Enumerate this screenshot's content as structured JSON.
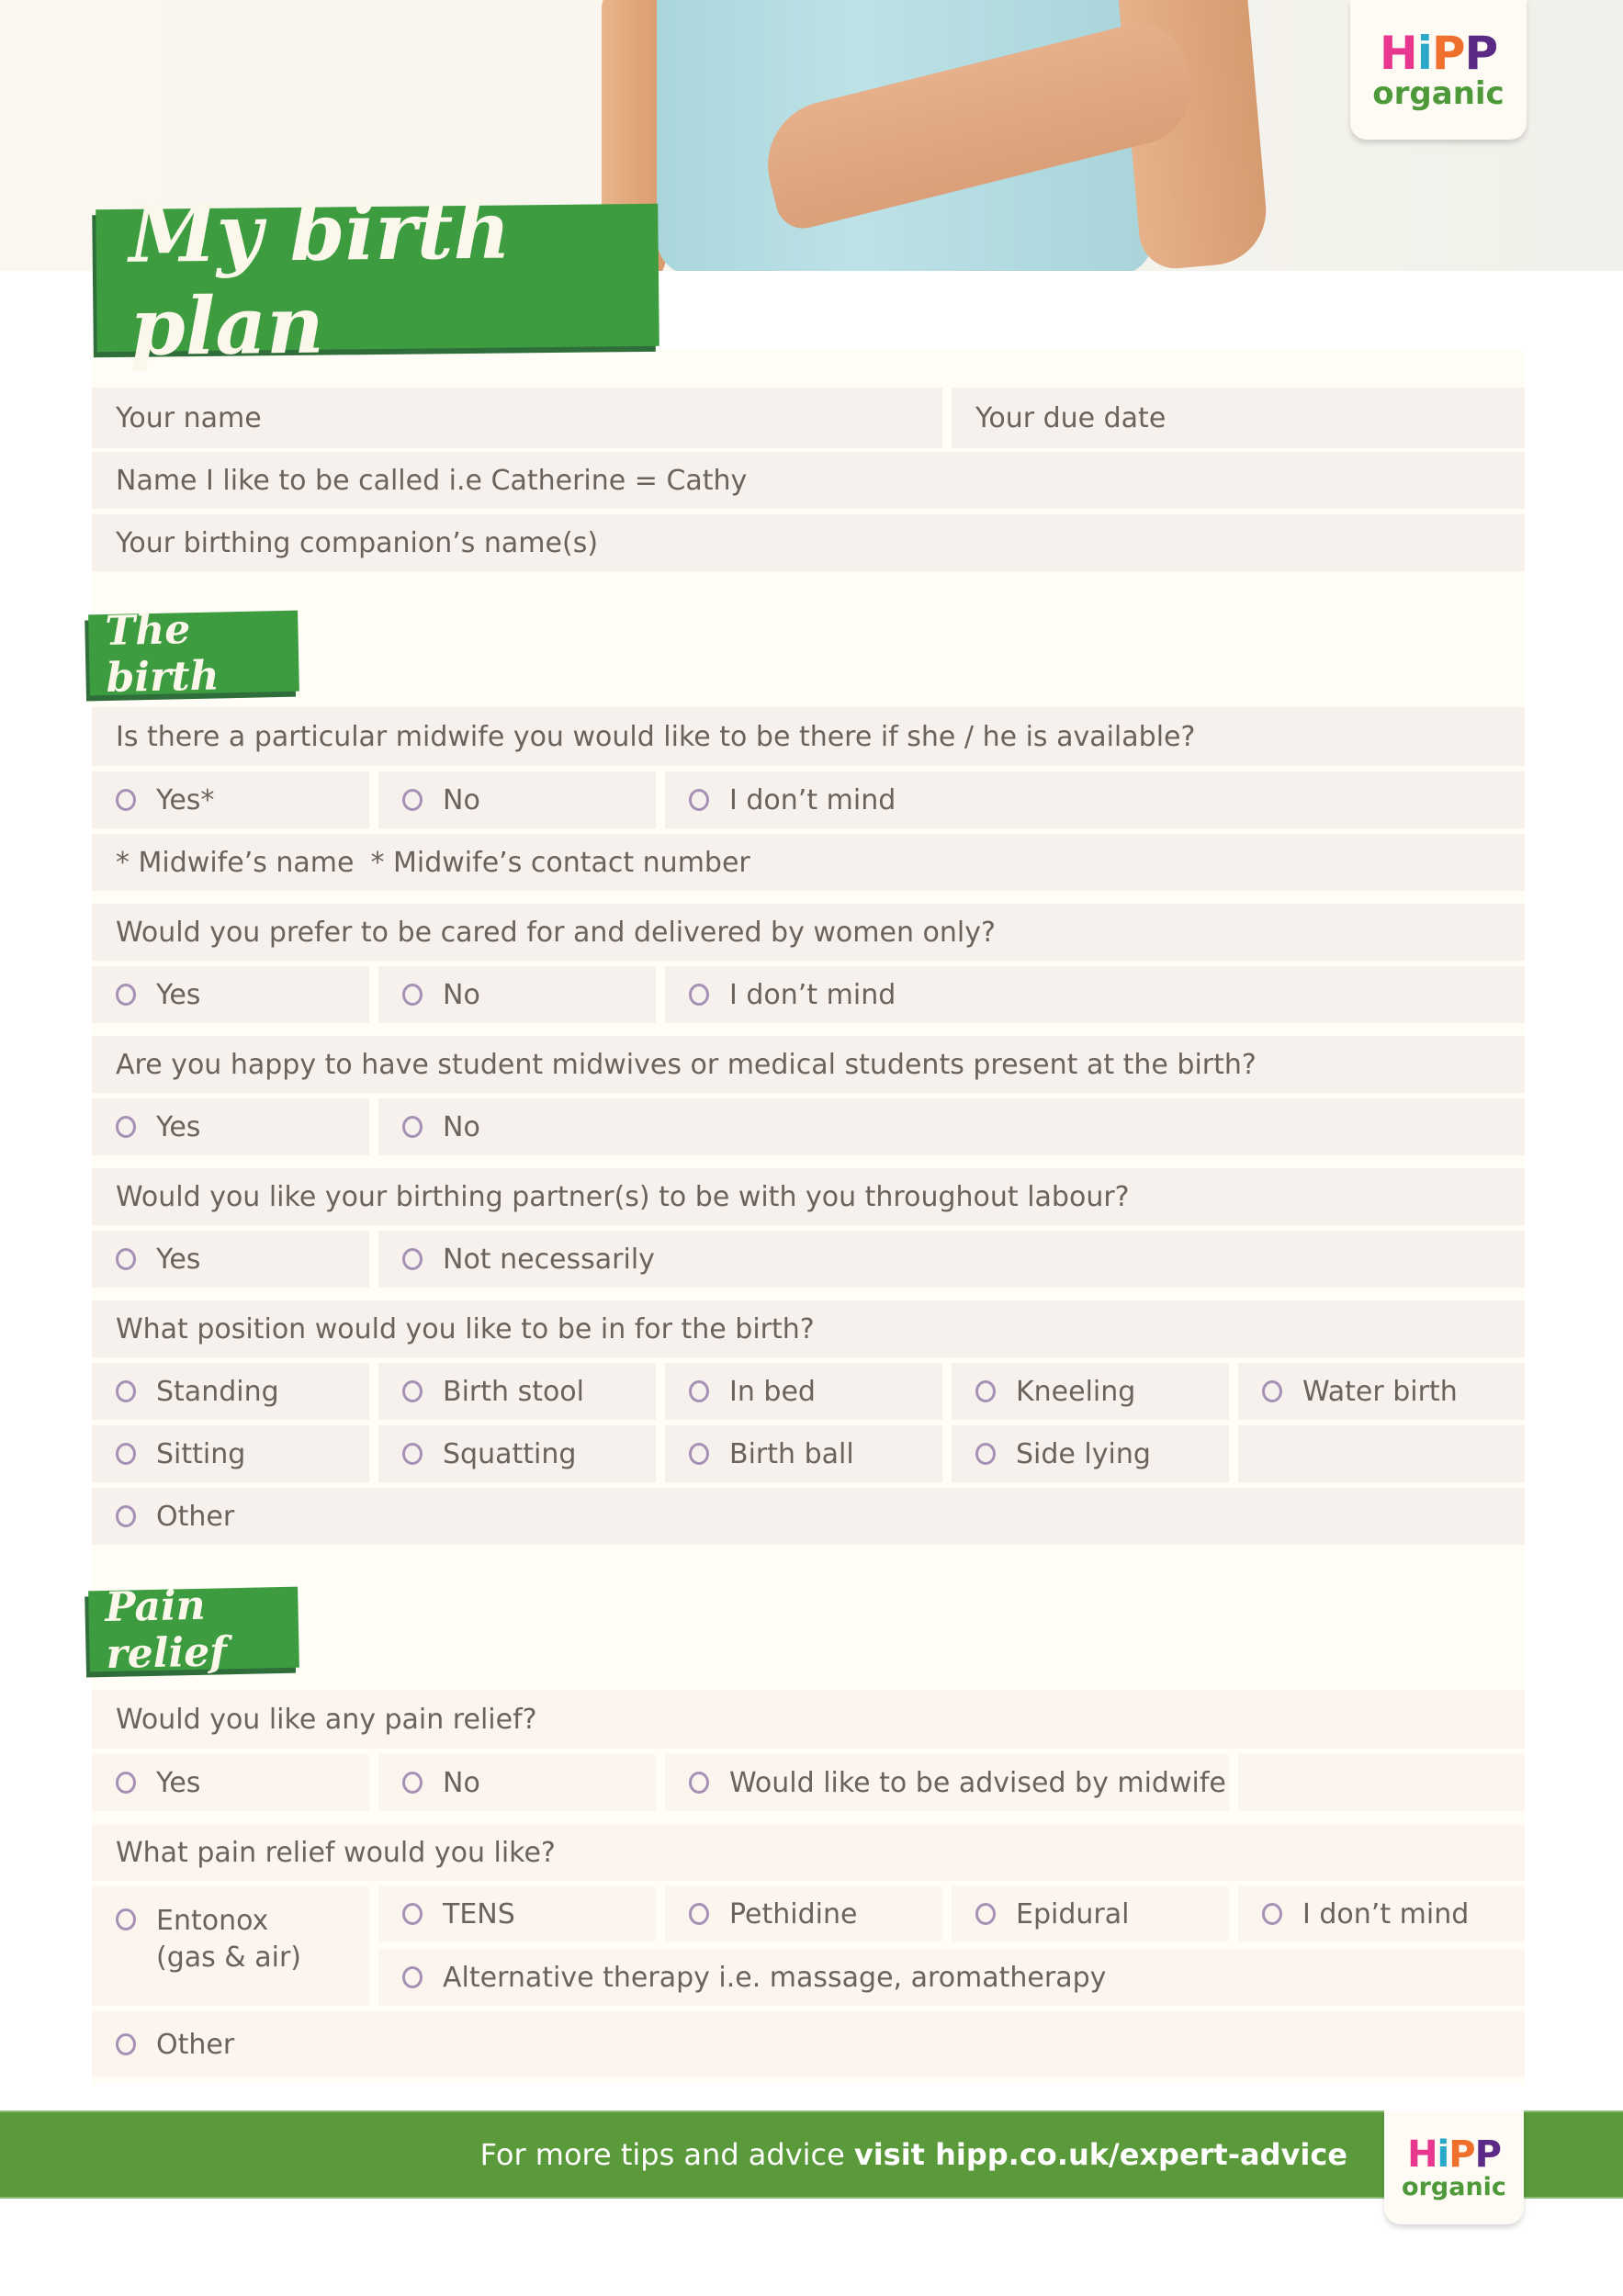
{
  "brand": {
    "logo_letters": [
      "H",
      "i",
      "P",
      "P"
    ],
    "logo_subtext": "organic",
    "colors": {
      "green": "#3d9c40",
      "footer_green": "#5a9a3a",
      "h_pink": "#e7378f",
      "i_blue": "#2aa8c7",
      "p_orange": "#ef6f2d",
      "p_purple": "#5b2a86",
      "radio_purple": "#a690b6",
      "field_bg": "#f6f1ec",
      "text": "#6b625d"
    }
  },
  "title": "My birth plan",
  "personal": {
    "your_name": "Your name",
    "due_date": "Your due date",
    "preferred_name": "Name I like to be called i.e Catherine = Cathy",
    "companion_names": "Your birthing companion’s name(s)"
  },
  "the_birth": {
    "heading": "The birth",
    "q_midwife": {
      "question": "Is there a particular midwife you would like to be there if she / he is available?",
      "options": [
        "Yes*",
        "No",
        "I don’t mind"
      ],
      "note_name": "* Midwife’s name",
      "note_contact": "* Midwife’s contact number"
    },
    "q_women_only": {
      "question": "Would you prefer to be cared for and delivered by women only?",
      "options": [
        "Yes",
        "No",
        "I don’t mind"
      ]
    },
    "q_students": {
      "question": "Are you happy to have student midwives or medical students present at the birth?",
      "options": [
        "Yes",
        "No"
      ]
    },
    "q_partner": {
      "question": "Would you like your birthing partner(s) to be with you throughout labour?",
      "options": [
        "Yes",
        "Not necessarily"
      ]
    },
    "q_position": {
      "question": "What position would you like to be in for the birth?",
      "row1": [
        "Standing",
        "Birth stool",
        "In bed",
        "Kneeling",
        "Water birth"
      ],
      "row2": [
        "Sitting",
        "Squatting",
        "Birth ball",
        "Side lying"
      ],
      "other": "Other"
    }
  },
  "pain_relief": {
    "heading": "Pain relief",
    "q_any": {
      "question": "Would you like any pain relief?",
      "options": [
        "Yes",
        "No",
        "Would like to be advised by midwife"
      ]
    },
    "q_which": {
      "question": "What pain relief would you like?",
      "entonox_line1": "Entonox",
      "entonox_line2": "(gas & air)",
      "row1": [
        "TENS",
        "Pethidine",
        "Epidural",
        "I don’t mind"
      ],
      "alternative": "Alternative therapy i.e. massage, aromatherapy",
      "other": "Other"
    }
  },
  "footer": {
    "text": "For more tips and advice",
    "link": "visit hipp.co.uk/expert-advice"
  }
}
